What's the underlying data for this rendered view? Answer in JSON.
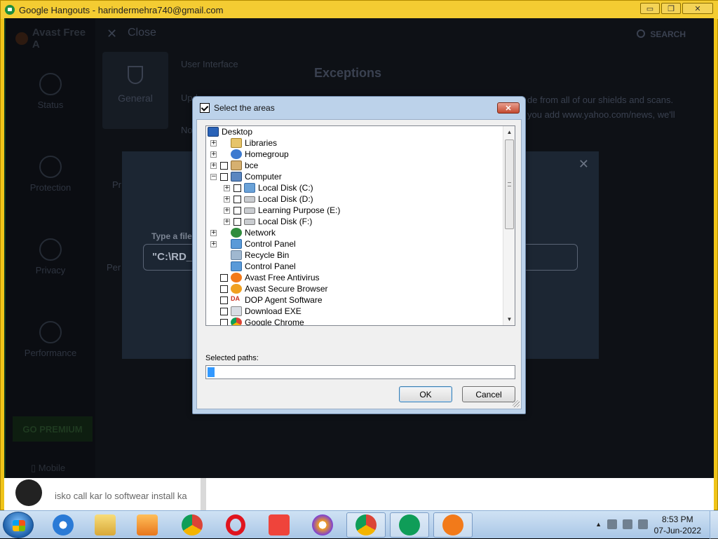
{
  "hangouts": {
    "title": "Google Hangouts - harindermehra740@gmail.com",
    "ctrl_min": "▭",
    "ctrl_max": "❐",
    "ctrl_close": "✕"
  },
  "avast": {
    "brand": "Avast Free A",
    "close_label": "Close",
    "search_label": "SEARCH",
    "sidebar": [
      "Status",
      "Protection",
      "Privacy",
      "Performance"
    ],
    "go_premium": "GO PREMIUM",
    "mobile": "Mobile",
    "general_tile": "General",
    "settings_items": [
      "User Interface",
      "Upd",
      "No"
    ],
    "exceptions_title": "Exceptions",
    "exceptions_desc_1": "de from all of our shields and scans.",
    "exceptions_desc_2": "you add www.yahoo.com/news, we'll",
    "side_partial_1": "Pr",
    "side_partial_2": "Per",
    "modal": {
      "type_label": "Type a file p",
      "path_value": "\"C:\\RD_"
    }
  },
  "chat": {
    "message": "isko call kar lo softwear install ka"
  },
  "dialog": {
    "title": "Select the areas",
    "close": "✕",
    "tree": [
      {
        "label": "Desktop",
        "level": 0,
        "expander": "",
        "checkbox": false,
        "icon": "desktop-icon"
      },
      {
        "label": "Libraries",
        "level": 1,
        "expander": "+",
        "checkbox": false,
        "icon": "libraries-icon"
      },
      {
        "label": "Homegroup",
        "level": 1,
        "expander": "+",
        "checkbox": false,
        "icon": "homegroup-icon"
      },
      {
        "label": "bce",
        "level": 1,
        "expander": "+",
        "checkbox": true,
        "icon": "user-folder-icon"
      },
      {
        "label": "Computer",
        "level": 1,
        "expander": "−",
        "checkbox": true,
        "icon": "computer-icon"
      },
      {
        "label": "Local Disk (C:)",
        "level": 2,
        "expander": "+",
        "checkbox": true,
        "icon": "system-disk-icon"
      },
      {
        "label": "Local Disk (D:)",
        "level": 2,
        "expander": "+",
        "checkbox": true,
        "icon": "disk-icon"
      },
      {
        "label": "Learning Purpose (E:)",
        "level": 2,
        "expander": "+",
        "checkbox": true,
        "icon": "disk-icon"
      },
      {
        "label": "Local Disk (F:)",
        "level": 2,
        "expander": "+",
        "checkbox": true,
        "icon": "disk-icon"
      },
      {
        "label": "Network",
        "level": 1,
        "expander": "+",
        "checkbox": false,
        "icon": "network-icon"
      },
      {
        "label": "Control Panel",
        "level": 1,
        "expander": "+",
        "checkbox": false,
        "icon": "control-panel-icon"
      },
      {
        "label": "Recycle Bin",
        "level": 1,
        "expander": "",
        "checkbox": false,
        "icon": "recycle-bin-icon"
      },
      {
        "label": "Control Panel",
        "level": 1,
        "expander": "",
        "checkbox": false,
        "icon": "control-panel-icon"
      },
      {
        "label": "Avast Free Antivirus",
        "level": 1,
        "expander": "",
        "checkbox": true,
        "icon": "avast-icon"
      },
      {
        "label": "Avast Secure Browser",
        "level": 1,
        "expander": "",
        "checkbox": true,
        "icon": "avast-browser-icon"
      },
      {
        "label": "DOP Agent Software",
        "level": 1,
        "expander": "",
        "checkbox": true,
        "icon": "dop-agent-icon"
      },
      {
        "label": "Download EXE",
        "level": 1,
        "expander": "",
        "checkbox": true,
        "icon": "download-exe-icon"
      },
      {
        "label": "Google Chrome",
        "level": 1,
        "expander": "",
        "checkbox": true,
        "icon": "chrome-icon"
      }
    ],
    "selected_paths_label": "Selected paths:",
    "selected_paths_value": "",
    "ok_label": "OK",
    "cancel_label": "Cancel"
  },
  "taskbar": {
    "apps": [
      "internet-explorer-icon",
      "file-explorer-icon",
      "media-player-icon",
      "chrome-icon",
      "opera-icon",
      "anydesk-icon",
      "avast-secure-browser-icon",
      "chrome-profile-icon",
      "hangouts-icon",
      "avast-icon"
    ],
    "time": "8:53 PM",
    "date": "07-Jun-2022"
  }
}
